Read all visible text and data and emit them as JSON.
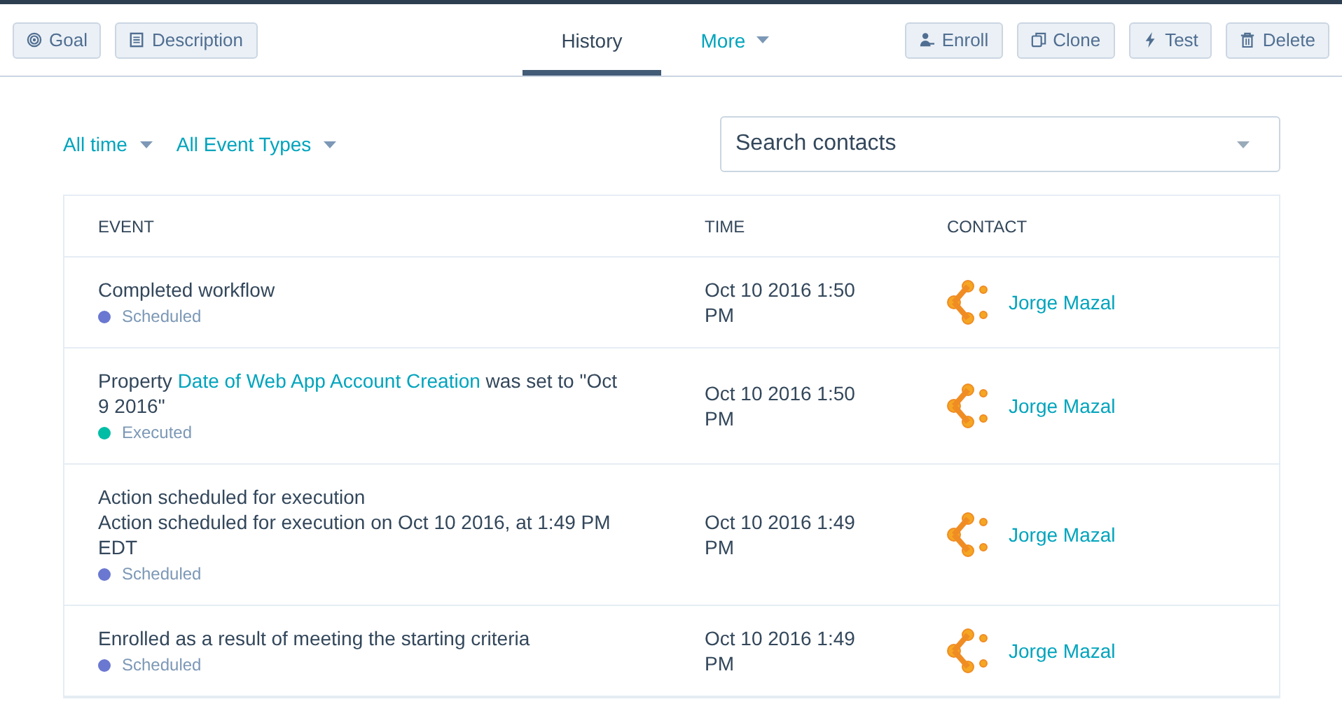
{
  "toolbar": {
    "left_buttons": [
      {
        "label": "Goal"
      },
      {
        "label": "Description"
      }
    ],
    "tabs": [
      {
        "label": "History",
        "selected": true,
        "dropdown": false
      },
      {
        "label": "More",
        "selected": false,
        "dropdown": true
      }
    ],
    "right_buttons": [
      {
        "label": "Enroll"
      },
      {
        "label": "Clone"
      },
      {
        "label": "Test"
      },
      {
        "label": "Delete"
      }
    ]
  },
  "filters": [
    {
      "label": "All time"
    },
    {
      "label": "All Event Types"
    }
  ],
  "search": {
    "placeholder": "Search contacts"
  },
  "table": {
    "columns": [
      "EVENT",
      "TIME",
      "CONTACT"
    ],
    "rows": [
      {
        "event": [
          {
            "text": "Completed workflow",
            "link": false
          }
        ],
        "detail": null,
        "status": {
          "label": "Scheduled",
          "color": "#6a78d1"
        },
        "time": "Oct 10 2016 1:50 PM",
        "contact": "Jorge Mazal"
      },
      {
        "event": [
          {
            "text": "Property ",
            "link": false
          },
          {
            "text": "Date of Web App Account Creation",
            "link": true
          },
          {
            "text": " was set to \"Oct 9 2016\"",
            "link": false
          }
        ],
        "detail": null,
        "status": {
          "label": "Executed",
          "color": "#00bda5"
        },
        "time": "Oct 10 2016 1:50 PM",
        "contact": "Jorge Mazal"
      },
      {
        "event": [
          {
            "text": "Action scheduled for execution",
            "link": false
          }
        ],
        "detail": "Action scheduled for execution on Oct 10 2016, at 1:49 PM EDT",
        "status": {
          "label": "Scheduled",
          "color": "#6a78d1"
        },
        "time": "Oct 10 2016 1:49 PM",
        "contact": "Jorge Mazal"
      },
      {
        "event": [
          {
            "text": "Enrolled as a result of meeting the starting criteria",
            "link": false
          }
        ],
        "detail": null,
        "status": {
          "label": "Scheduled",
          "color": "#6a78d1"
        },
        "time": "Oct 10 2016 1:49 PM",
        "contact": "Jorge Mazal"
      }
    ]
  }
}
